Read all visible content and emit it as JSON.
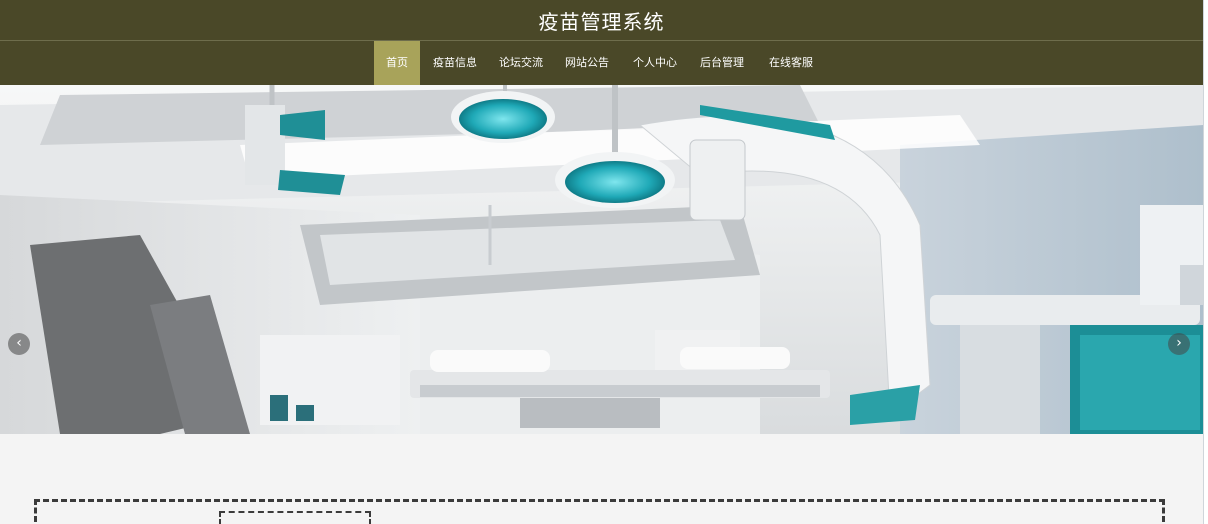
{
  "site": {
    "title": "疫苗管理系统"
  },
  "nav": {
    "items": [
      {
        "label": "首页",
        "active": true
      },
      {
        "label": "疫苗信息"
      },
      {
        "label": "论坛交流"
      },
      {
        "label": "网站公告"
      },
      {
        "label": "个人中心"
      },
      {
        "label": "后台管理"
      },
      {
        "label": "在线客服"
      }
    ]
  },
  "carousel": {
    "prev_icon": "‹",
    "next_icon": "›",
    "slide_count": 3,
    "active_slide": 1
  },
  "colors": {
    "header_bg": "#4a4828",
    "nav_active": "#a8a35a",
    "teal_accent": "#1f9aa0",
    "page_bg": "#f4f4f4"
  }
}
